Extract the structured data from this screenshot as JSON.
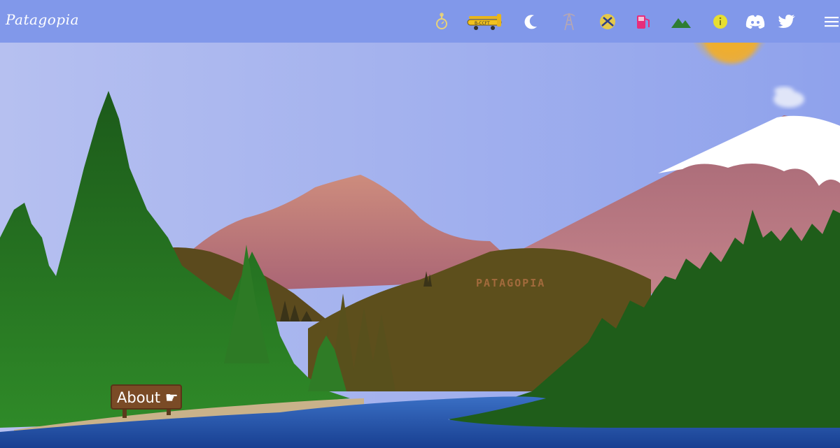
{
  "site": {
    "brand": "Patagopia"
  },
  "nav": {
    "items": [
      {
        "name": "pocket-watch-icon"
      },
      {
        "name": "biplane-icon",
        "plane_reg": "B-CCFT"
      },
      {
        "name": "moon-icon"
      },
      {
        "name": "radio-tower-icon"
      },
      {
        "name": "pickaxes-icon"
      },
      {
        "name": "fuel-pump-icon"
      },
      {
        "name": "mountain-icon"
      },
      {
        "name": "info-icon"
      },
      {
        "name": "discord-icon"
      },
      {
        "name": "twitter-icon"
      },
      {
        "name": "hamburger-menu-icon"
      }
    ]
  },
  "scene": {
    "hill_text": "PATAGOPIA",
    "about_sign": "About ☛"
  },
  "colors": {
    "sky_top": "#8198ea",
    "sky_bottom": "#b1bdf0",
    "mountain": "#a86876",
    "snow": "#ffffff",
    "hill": "#5d4f1c",
    "forest": "#1f5d1a",
    "lake": "#2e5fb0",
    "sun": "#f3b62a"
  }
}
